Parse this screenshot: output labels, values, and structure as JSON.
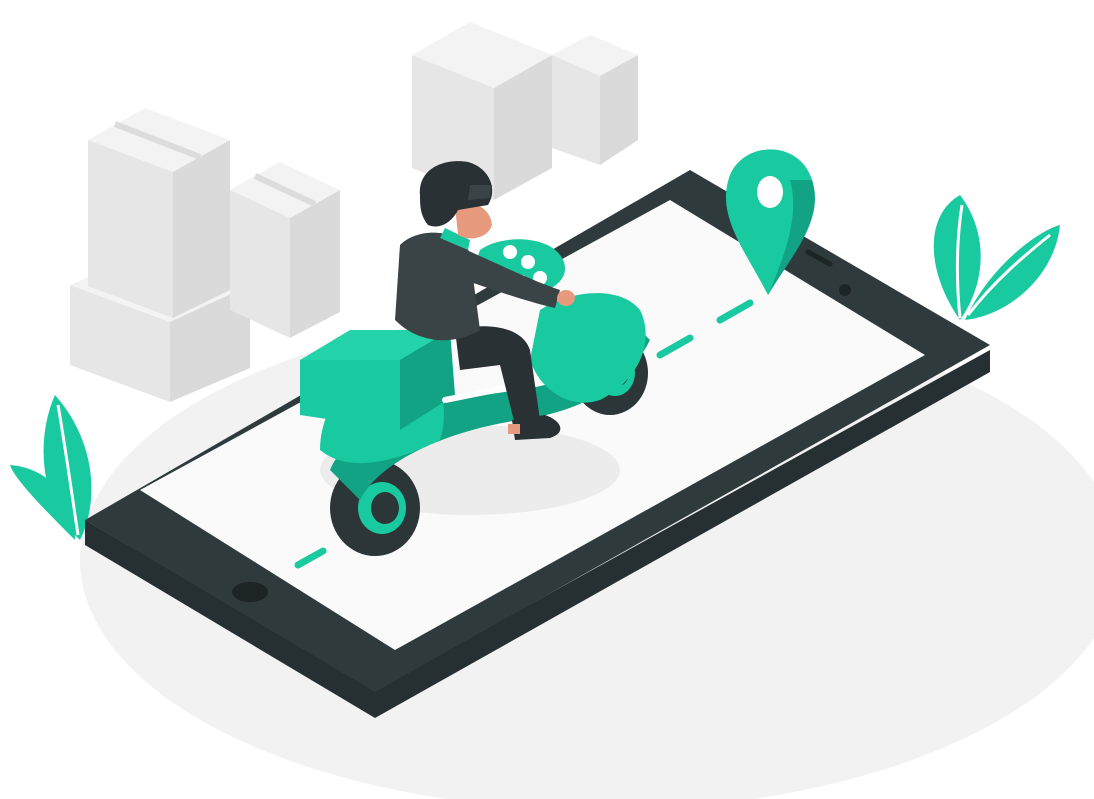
{
  "illustration": {
    "subject": "scooter-delivery-on-smartphone",
    "colors": {
      "background": "#ffffff",
      "ground": "#f2f2f2",
      "phone_body": "#2f3a3d",
      "phone_side": "#263033",
      "phone_screen": "#fafafa",
      "accent": "#19c9a0",
      "accent_dark": "#11a383",
      "rider": "#3a4346",
      "rider_dark": "#2a3134",
      "skin": "#e89a7f",
      "box_light": "#eeeeee",
      "box_mid": "#e2e2e2",
      "box_dark": "#d6d6d6",
      "tire": "#2c3538"
    },
    "icons": [
      "map-pin-icon",
      "leaf-icon",
      "box-icon"
    ]
  }
}
